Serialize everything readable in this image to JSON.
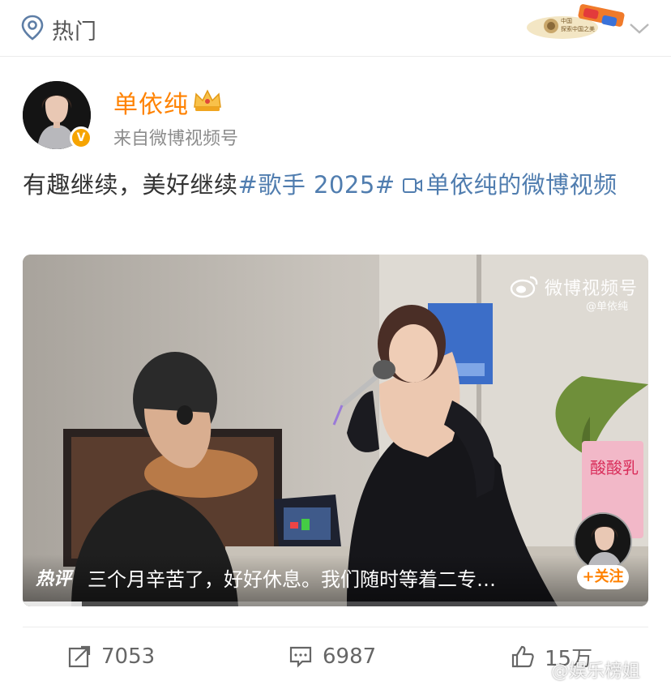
{
  "header": {
    "section_label": "热门",
    "banner_text": "探索中国之美"
  },
  "author": {
    "name": "单依纯",
    "source": "来自微博视频号",
    "verified_badge": "V"
  },
  "post": {
    "text_main": "有趣继续，美好继续",
    "hashtag": "#歌手 2025#",
    "video_link": "单依纯的微博视频"
  },
  "video": {
    "watermark_title": "微博视频号",
    "watermark_handle": "@单依纯",
    "hot_comment_tag": "热评",
    "hot_comment_text": "三个月辛苦了，好好休息。我们随时等着二专…",
    "follow_label": "+关注",
    "progress": 0.095
  },
  "actions": {
    "repost_count": "7053",
    "comment_count": "6987",
    "like_count": "15万"
  },
  "watermark": "@娱乐榜姐",
  "colors": {
    "accent": "#ff8200",
    "link": "#507daf",
    "text": "#333333",
    "muted": "#8c8c8c"
  },
  "icons": [
    "location-pin-icon",
    "chevron-down-icon",
    "crown-icon",
    "video-link-icon",
    "weibo-logo-icon",
    "repost-icon",
    "comment-icon",
    "like-icon"
  ]
}
